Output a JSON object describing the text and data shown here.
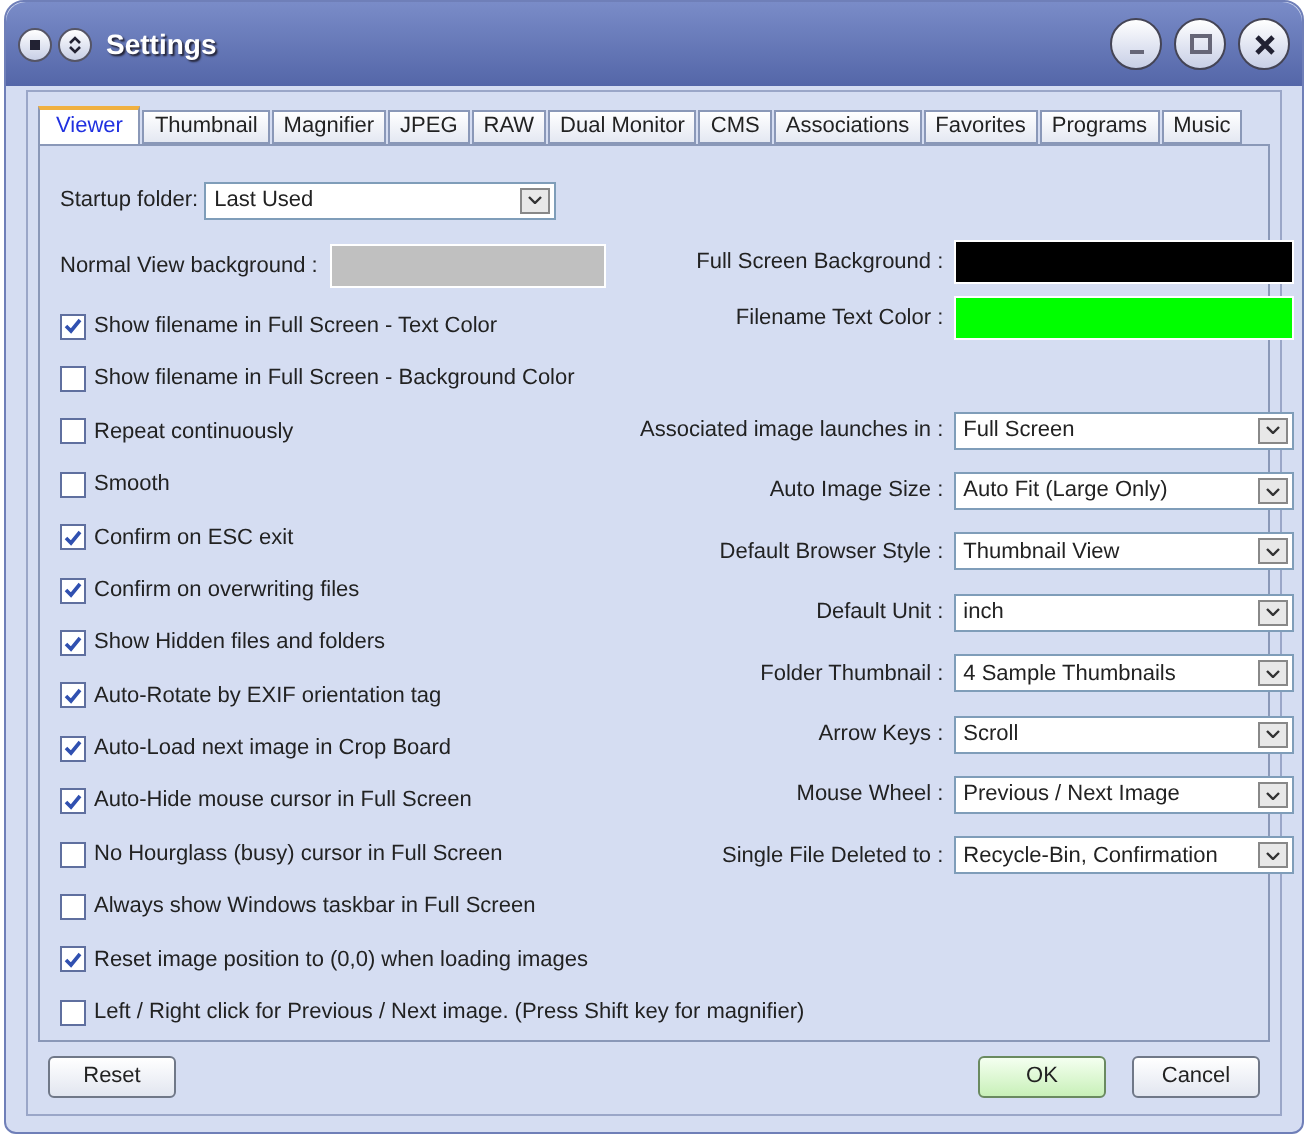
{
  "window": {
    "title": "Settings"
  },
  "tabs": [
    {
      "label": "Viewer",
      "selected": true
    },
    {
      "label": "Thumbnail",
      "selected": false
    },
    {
      "label": "Magnifier",
      "selected": false
    },
    {
      "label": "JPEG",
      "selected": false
    },
    {
      "label": "RAW",
      "selected": false
    },
    {
      "label": "Dual Monitor",
      "selected": false
    },
    {
      "label": "CMS",
      "selected": false
    },
    {
      "label": "Associations",
      "selected": false
    },
    {
      "label": "Favorites",
      "selected": false
    },
    {
      "label": "Programs",
      "selected": false
    },
    {
      "label": "Music",
      "selected": false
    }
  ],
  "startup_folder": {
    "label": "Startup folder:",
    "value": "Last Used"
  },
  "normal_view_background": {
    "label": "Normal View background :",
    "color": "#c0c0c0"
  },
  "checkboxes": [
    {
      "label": "Show filename in Full Screen - Text Color",
      "checked": true
    },
    {
      "label": "Show filename in Full Screen - Background Color",
      "checked": false
    },
    {
      "label": "Repeat continuously",
      "checked": false
    },
    {
      "label": "Smooth",
      "checked": false
    },
    {
      "label": "Confirm on ESC exit",
      "checked": true
    },
    {
      "label": "Confirm on overwriting files",
      "checked": true
    },
    {
      "label": "Show Hidden files and folders",
      "checked": true
    },
    {
      "label": "Auto-Rotate by EXIF orientation tag",
      "checked": true
    },
    {
      "label": "Auto-Load next image in Crop Board",
      "checked": true
    },
    {
      "label": "Auto-Hide mouse cursor in Full Screen",
      "checked": true
    },
    {
      "label": "No Hourglass (busy) cursor in Full Screen",
      "checked": false
    },
    {
      "label": "Always show Windows taskbar in Full Screen",
      "checked": false
    },
    {
      "label": "Reset image position to (0,0) when loading images",
      "checked": true
    },
    {
      "label": "Left / Right click for Previous / Next image. (Press Shift key for magnifier)",
      "checked": false
    }
  ],
  "color_settings": [
    {
      "label": "Full Screen Background :",
      "color": "#000000"
    },
    {
      "label": "Filename Text Color :",
      "color": "#00ff00"
    }
  ],
  "dropdowns": [
    {
      "label": "Associated image launches in :",
      "value": "Full Screen"
    },
    {
      "label": "Auto Image Size :",
      "value": "Auto Fit (Large Only)"
    },
    {
      "label": "Default Browser Style :",
      "value": "Thumbnail View"
    },
    {
      "label": "Default Unit :",
      "value": "inch"
    },
    {
      "label": "Folder Thumbnail :",
      "value": "4 Sample Thumbnails"
    },
    {
      "label": "Arrow Keys :",
      "value": "Scroll"
    },
    {
      "label": "Mouse Wheel :",
      "value": "Previous / Next Image"
    },
    {
      "label": "Single File Deleted to :",
      "value": "Recycle-Bin, Confirmation"
    }
  ],
  "buttons": [
    {
      "label": "Reset",
      "kind": "plain"
    },
    {
      "label": "OK",
      "kind": "default"
    },
    {
      "label": "Cancel",
      "kind": "plain"
    }
  ]
}
